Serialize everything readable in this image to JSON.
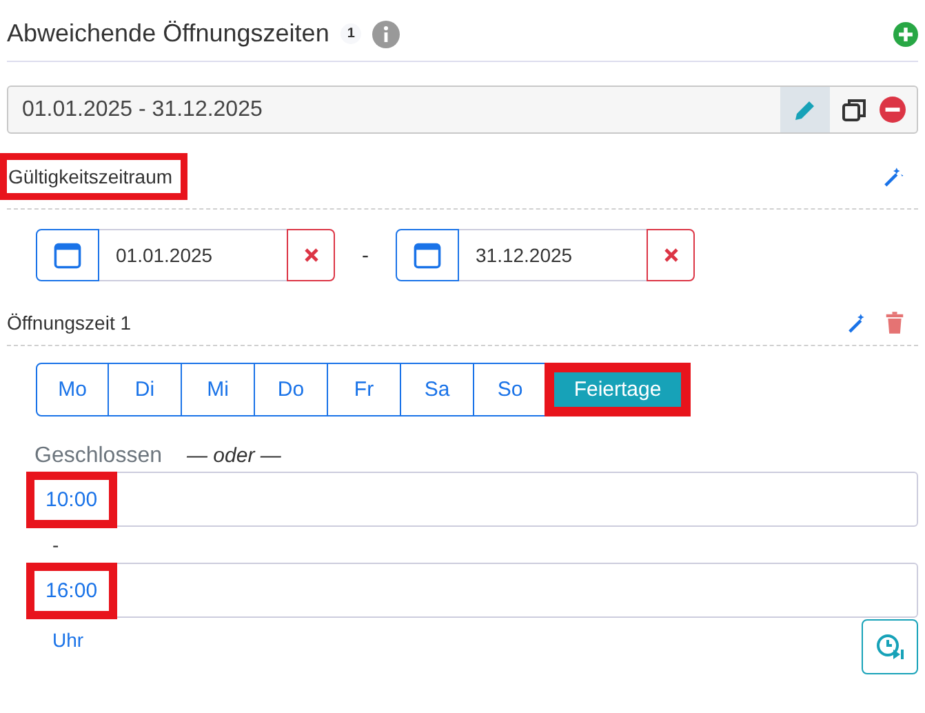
{
  "header": {
    "title": "Abweichende Öffnungszeiten",
    "count": "1"
  },
  "period_row": {
    "value": "01.01.2025 - 31.12.2025",
    "edit_selected": true
  },
  "validity": {
    "label": "Gültigkeitszeitraum",
    "highlighted": true,
    "from": "01.01.2025",
    "separator": "-",
    "to": "31.12.2025"
  },
  "opening": {
    "label": "Öffnungszeit 1",
    "days": [
      {
        "label": "Mo",
        "selected": false,
        "highlighted": false
      },
      {
        "label": "Di",
        "selected": false,
        "highlighted": false
      },
      {
        "label": "Mi",
        "selected": false,
        "highlighted": false
      },
      {
        "label": "Do",
        "selected": false,
        "highlighted": false
      },
      {
        "label": "Fr",
        "selected": false,
        "highlighted": false
      },
      {
        "label": "Sa",
        "selected": false,
        "highlighted": false
      },
      {
        "label": "So",
        "selected": false,
        "highlighted": false
      },
      {
        "label": "Feiertage",
        "selected": true,
        "highlighted": true
      }
    ],
    "closed_label": "Geschlossen",
    "or_label": "— oder —",
    "start": {
      "value": "10:00",
      "highlighted": true
    },
    "separator": "-",
    "end": {
      "value": "16:00",
      "highlighted": true
    },
    "unit": "Uhr"
  }
}
